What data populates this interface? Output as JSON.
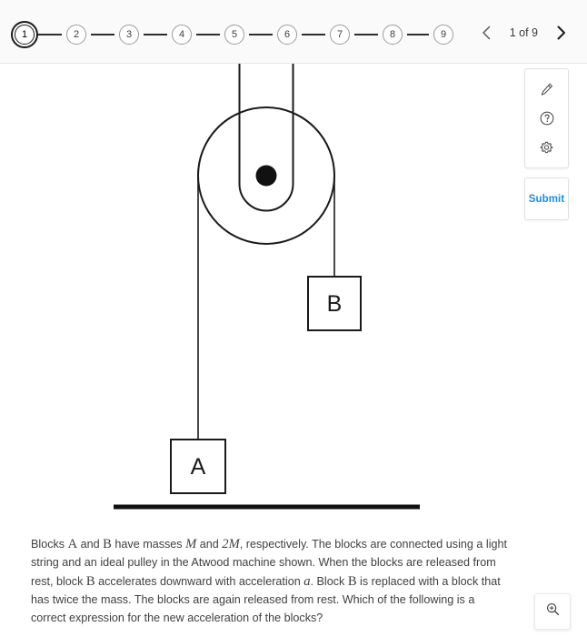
{
  "header": {
    "steps": [
      {
        "label": "1",
        "active": true
      },
      {
        "label": "2",
        "active": false
      },
      {
        "label": "3",
        "active": false
      },
      {
        "label": "4",
        "active": false
      },
      {
        "label": "5",
        "active": false
      },
      {
        "label": "6",
        "active": false
      },
      {
        "label": "7",
        "active": false
      },
      {
        "label": "8",
        "active": false
      },
      {
        "label": "9",
        "active": false
      }
    ],
    "pager": {
      "prev_icon": "chevron-left-icon",
      "next_icon": "chevron-right-icon",
      "label": "1 of 9"
    }
  },
  "tools": {
    "items": [
      {
        "icon": "pencil-icon",
        "name": "annotate-tool"
      },
      {
        "icon": "question-circle-icon",
        "name": "help-tool"
      },
      {
        "icon": "gear-icon",
        "name": "settings-tool"
      }
    ],
    "submit_label": "Submit",
    "submit_color": "#1b8fe0",
    "zoom_icon": "zoom-in-icon"
  },
  "figure": {
    "name": "atwood-machine-diagram",
    "block_a_label": "A",
    "block_b_label": "B",
    "ceiling": "support-bar",
    "floor": "ground-bar",
    "pulley": "pulley-wheel",
    "axle": "pulley-axle",
    "stroke_color": "#1a1a1a"
  },
  "question": {
    "text_plain": "Blocks A and B have masses M and 2M, respectively. The blocks are connected using a light string and an ideal pulley in the Atwood machine shown. When the blocks are released from rest, block B accelerates downward with acceleration a. Block B is replaced with a block that has twice the mass. The blocks are again released from rest. Which of the following is a correct expression for the new acceleration of the blocks?",
    "seg1": "Blocks ",
    "sym_a": "A",
    "seg2": " and ",
    "sym_b": "B",
    "seg3": " have masses ",
    "sym_m": "M",
    "seg4": " and ",
    "sym_2m": "2M",
    "seg5": ", respectively. The blocks are connected using a light string and an ideal pulley in the Atwood machine shown. When the blocks are released from rest, block ",
    "sym_b2": "B",
    "seg6": " accelerates downward with acceleration ",
    "sym_accel": "a",
    "seg7": ". Block ",
    "sym_b3": "B",
    "seg8": " is replaced with a block that has twice the mass. The blocks are again released from rest. Which of the following is a correct expression for the new acceleration of the blocks?"
  }
}
